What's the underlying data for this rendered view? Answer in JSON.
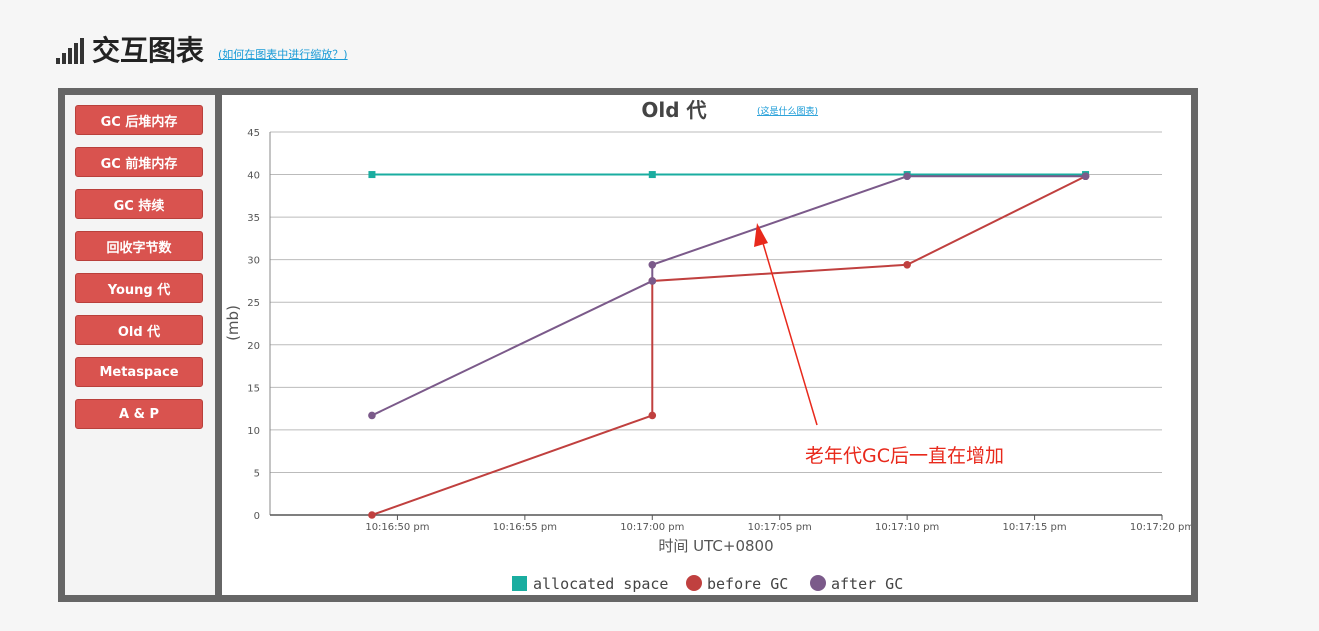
{
  "header": {
    "title": "交互图表",
    "zoom_help": "(如何在图表中进行缩放？)"
  },
  "sidebar": {
    "items": [
      {
        "label": "GC 后堆内存"
      },
      {
        "label": "GC 前堆内存"
      },
      {
        "label": "GC 持续"
      },
      {
        "label": "回收字节数"
      },
      {
        "label": "Young 代"
      },
      {
        "label": "Old 代"
      },
      {
        "label": "Metaspace"
      },
      {
        "label": "A & P"
      }
    ]
  },
  "colors": {
    "button": "#d9534f",
    "allocated": "#1aada0",
    "before": "#c0403f",
    "after": "#7b5a8a"
  },
  "chart_data": {
    "type": "line",
    "title": "Old 代",
    "help_link": "(这是什么图表)",
    "xlabel": "时间 UTC+0800",
    "ylabel": "(mb)",
    "ylim": [
      0,
      45
    ],
    "yticks": [
      0,
      5,
      10,
      15,
      20,
      25,
      30,
      35,
      40,
      45
    ],
    "xlim": [
      "10:16:45 pm",
      "10:17:20 pm"
    ],
    "xticks": [
      "10:16:50 pm",
      "10:16:55 pm",
      "10:17:00 pm",
      "10:17:05 pm",
      "10:17:10 pm",
      "10:17:15 pm",
      "10:17:20 pm"
    ],
    "grid": true,
    "legend_position": "bottom",
    "series": [
      {
        "name": "allocated space",
        "color": "#1aada0",
        "marker": "square",
        "points": [
          [
            "10:16:49 pm",
            40
          ],
          [
            "10:17:00 pm",
            40
          ],
          [
            "10:17:10 pm",
            40
          ],
          [
            "10:17:17 pm",
            40
          ]
        ]
      },
      {
        "name": "before GC",
        "color": "#c0403f",
        "marker": "circle",
        "points": [
          [
            "10:16:49 pm",
            0
          ],
          [
            "10:17:00 pm",
            11.7
          ],
          [
            "10:17:00 pm",
            27.5
          ],
          [
            "10:17:10 pm",
            29.4
          ],
          [
            "10:17:17 pm",
            39.8
          ]
        ]
      },
      {
        "name": "after GC",
        "color": "#7b5a8a",
        "marker": "circle",
        "points": [
          [
            "10:16:49 pm",
            11.7
          ],
          [
            "10:17:00 pm",
            27.5
          ],
          [
            "10:17:00 pm",
            29.4
          ],
          [
            "10:17:10 pm",
            39.8
          ],
          [
            "10:17:17 pm",
            39.8
          ]
        ]
      }
    ],
    "annotation": "老年代GC后一直在增加"
  }
}
